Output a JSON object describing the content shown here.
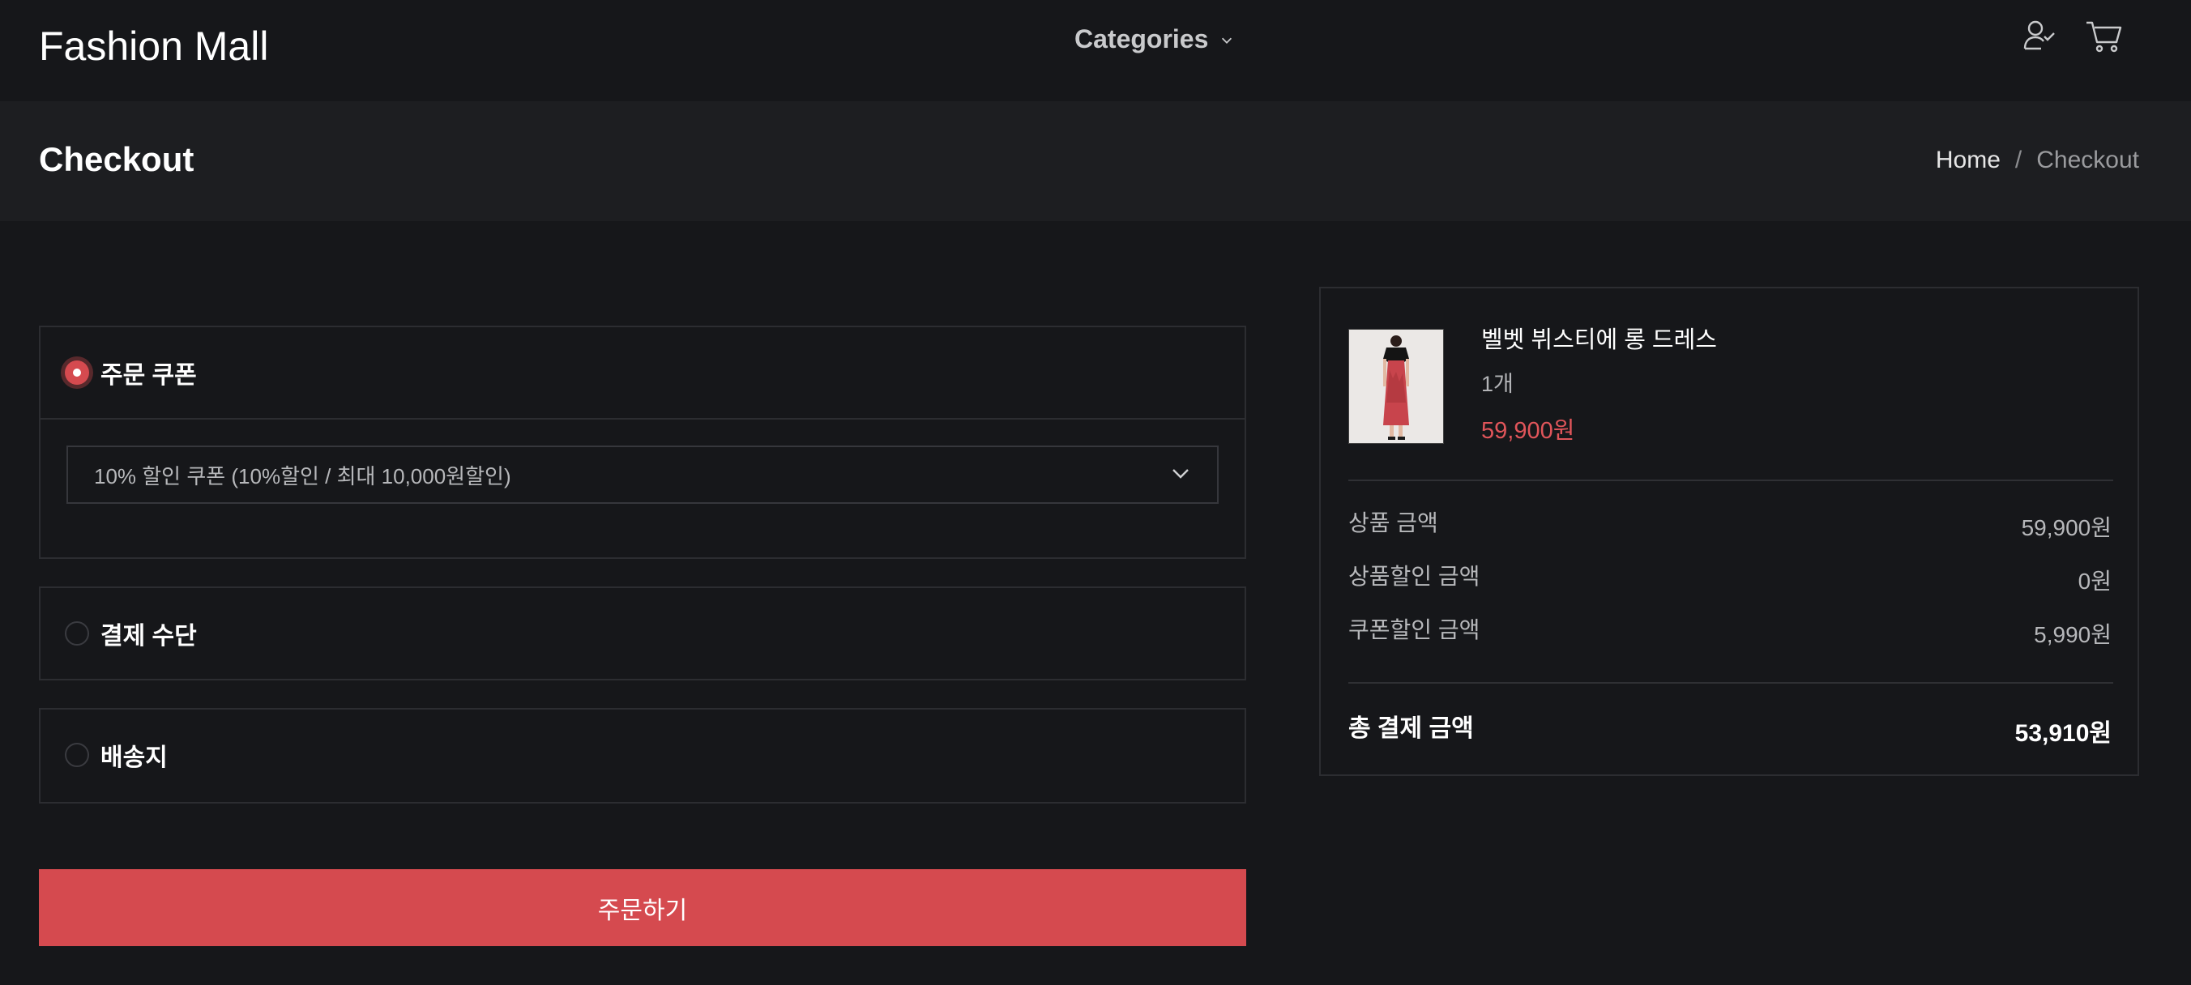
{
  "header": {
    "brand": "Fashion Mall",
    "categories_label": "Categories"
  },
  "page": {
    "title": "Checkout",
    "breadcrumb": {
      "home": "Home",
      "separator": "/",
      "current": "Checkout"
    }
  },
  "sections": {
    "coupon": {
      "label": "주문 쿠폰",
      "selected": true,
      "selected_option": "10% 할인 쿠폰 (10%할인 / 최대 10,000원할인)"
    },
    "payment": {
      "label": "결제 수단",
      "selected": false
    },
    "shipping": {
      "label": "배송지",
      "selected": false
    }
  },
  "order_button": "주문하기",
  "summary": {
    "product": {
      "name": "벨벳 뷔스티에 롱 드레스",
      "quantity": "1개",
      "price": "59,900원"
    },
    "rows": [
      {
        "label": "상품 금액",
        "value": "59,900원"
      },
      {
        "label": "상품할인 금액",
        "value": "0원"
      },
      {
        "label": "쿠폰할인 금액",
        "value": "5,990원"
      }
    ],
    "total": {
      "label": "총 결제 금액",
      "value": "53,910원"
    }
  },
  "colors": {
    "accent": "#d54a4f",
    "price": "#e0555a",
    "background": "#16171a",
    "title_band": "#1d1e21",
    "border": "#2c2d31"
  },
  "icons": [
    "chevron-down-icon",
    "user-check-icon",
    "cart-icon"
  ]
}
